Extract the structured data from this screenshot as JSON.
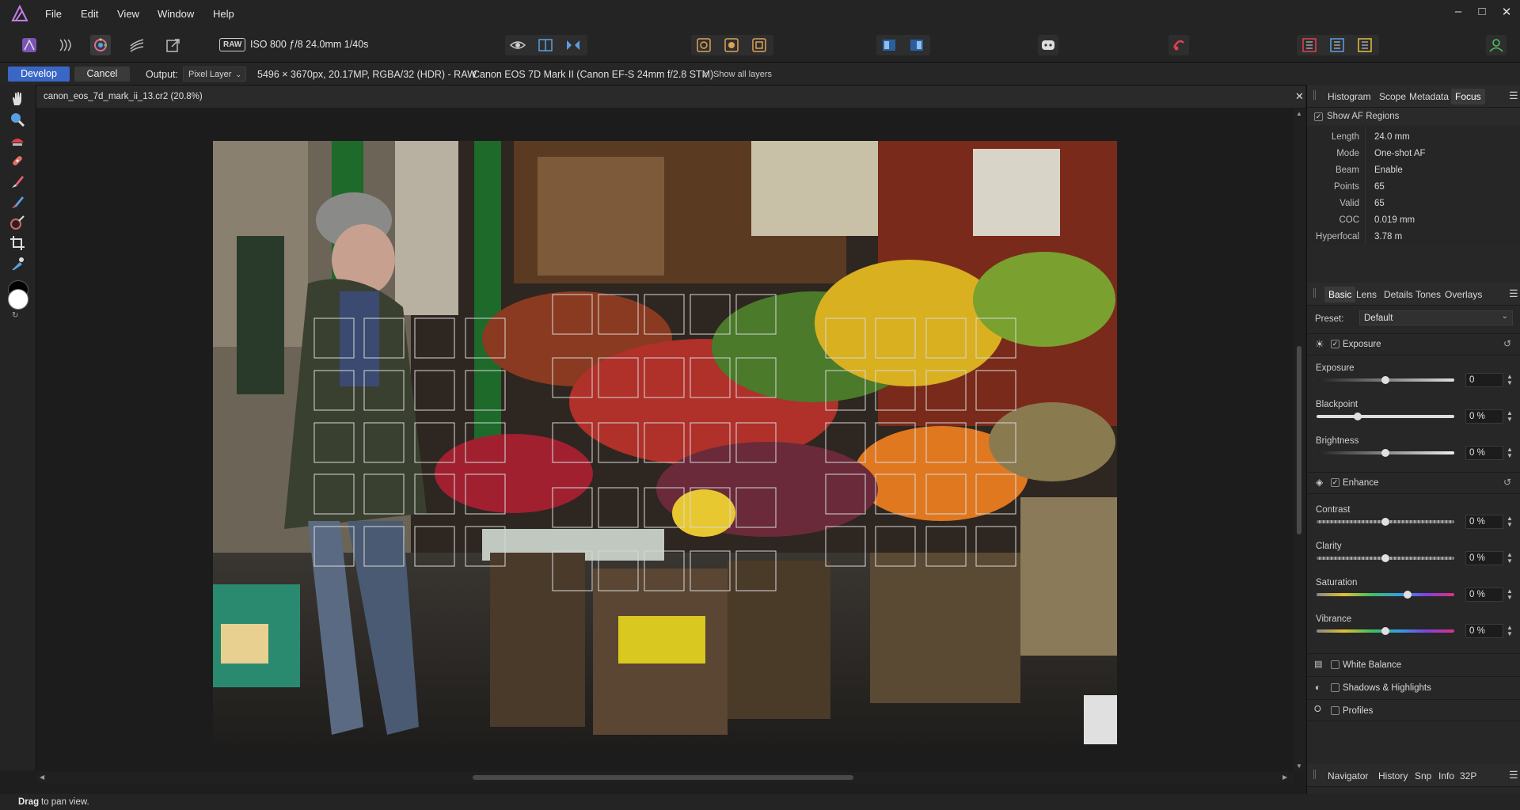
{
  "menubar": {
    "items": [
      "File",
      "Edit",
      "View",
      "Window",
      "Help"
    ],
    "window_controls": [
      "minimize-icon",
      "maximize-icon",
      "close-icon"
    ]
  },
  "toolbar": {
    "raw_badge": "RAW",
    "raw_info": "ISO 800 ƒ/8 24.0mm 1/40s"
  },
  "context_bar": {
    "develop_label": "Develop",
    "cancel_label": "Cancel",
    "output_label": "Output:",
    "output_value": "Pixel Layer",
    "image_info": "5496 × 3670px, 20.17MP, RGBA/32 (HDR) - RAW",
    "camera_info": "Canon EOS 7D Mark II (Canon EF-S 24mm f/2.8 STM)",
    "show_all_layers": "Show all layers",
    "show_all_layers_checked": true
  },
  "document": {
    "tab_title": "canon_eos_7d_mark_ii_13.cr2 (20.8%)"
  },
  "focus_panel": {
    "tabs": [
      "Histogram",
      "Scope",
      "Metadata",
      "Focus"
    ],
    "active_tab": "Focus",
    "show_af_regions": "Show AF Regions",
    "show_af_checked": true,
    "rows": [
      {
        "key": "Length",
        "value": "24.0 mm"
      },
      {
        "key": "Mode",
        "value": "One-shot AF"
      },
      {
        "key": "Beam",
        "value": "Enable"
      },
      {
        "key": "Points",
        "value": "65"
      },
      {
        "key": "Valid",
        "value": "65"
      },
      {
        "key": "COC",
        "value": "0.019 mm"
      },
      {
        "key": "Hyperfocal",
        "value": "3.78 m"
      }
    ]
  },
  "develop_panel": {
    "tabs": [
      "Basic",
      "Lens",
      "Details",
      "Tones",
      "Overlays"
    ],
    "active_tab": "Basic",
    "preset_label": "Preset:",
    "preset_value": "Default",
    "exposure_section": "Exposure",
    "enhance_section": "Enhance",
    "sliders": [
      {
        "label": "Exposure",
        "value": "0",
        "level": 0.5
      },
      {
        "label": "Blackpoint",
        "value": "0 %",
        "level": 0.3
      },
      {
        "label": "Brightness",
        "value": "0 %",
        "level": 0.5
      },
      {
        "label": "Contrast",
        "value": "0 %",
        "level": 0.5
      },
      {
        "label": "Clarity",
        "value": "0 %",
        "level": 0.5
      },
      {
        "label": "Saturation",
        "value": "0 %",
        "level": 0.66
      },
      {
        "label": "Vibrance",
        "value": "0 %",
        "level": 0.5
      }
    ],
    "extra_sections": [
      "White Balance",
      "Shadows & Highlights",
      "Profiles"
    ]
  },
  "bottom_panel": {
    "tabs": [
      "Navigator",
      "History",
      "Snp",
      "Info",
      "32P"
    ]
  },
  "status": {
    "bold": "Drag",
    "text": " to pan view."
  },
  "colors": {
    "accent": "#3a67c5",
    "af_box": "#d8d8d8"
  }
}
